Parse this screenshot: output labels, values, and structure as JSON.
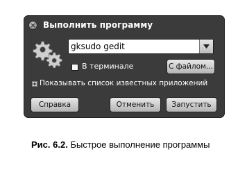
{
  "dialog": {
    "title": "Выполнить программу",
    "command_value": "gksudo gedit",
    "in_terminal_label": "В терминале",
    "in_terminal_checked": false,
    "file_button_label": "С файлом...",
    "show_apps_label": "Показывать список известных приложений",
    "help_button_label": "Справка",
    "cancel_button_label": "Отменить",
    "run_button_label": "Запустить"
  },
  "caption": {
    "label": "Рис. 6.2.",
    "text": "Быстрое выполнение программы"
  }
}
